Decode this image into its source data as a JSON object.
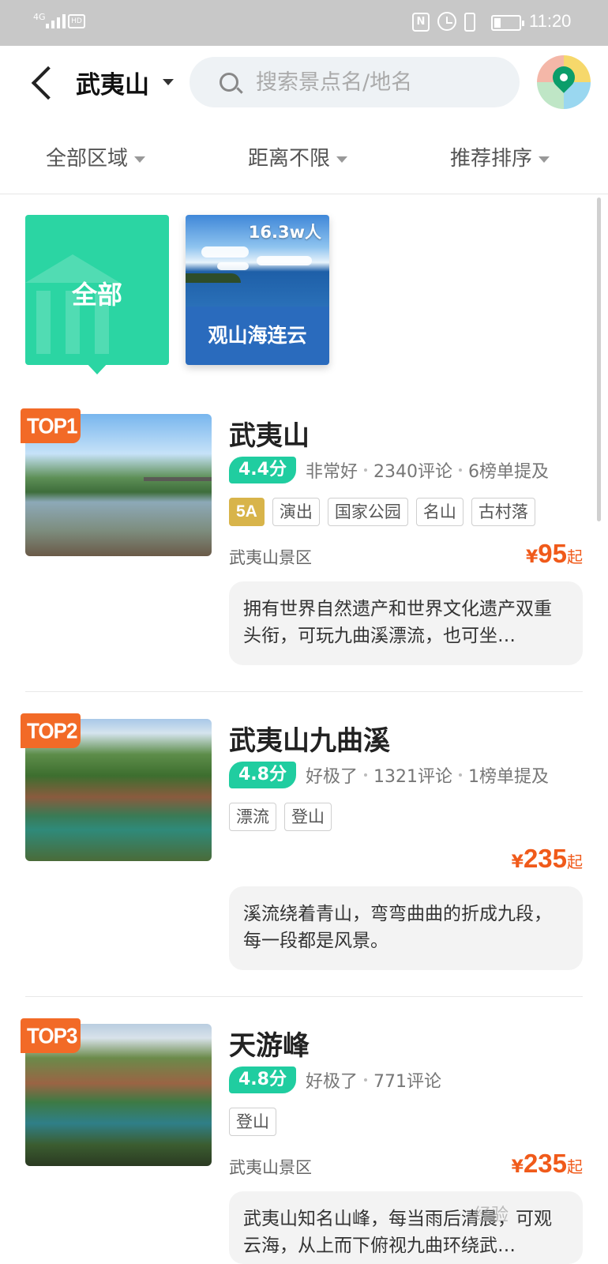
{
  "status_bar": {
    "network": "4G",
    "time": "11:20",
    "hd": "HD"
  },
  "header": {
    "city": "武夷山",
    "search_placeholder": "搜索景点名/地名"
  },
  "filters": [
    "全部区域",
    "距离不限",
    "推荐排序"
  ],
  "categories": {
    "all_label": "全部",
    "featured": {
      "name": "观山海连云",
      "count": "16.3w人"
    }
  },
  "items": [
    {
      "rank": "TOP1",
      "title": "武夷山",
      "score": "4.4分",
      "rating_text": "非常好",
      "reviews": "2340评论",
      "mentions": "6榜单提及",
      "tags": [
        "5A",
        "演出",
        "国家公园",
        "名山",
        "古村落"
      ],
      "area": "武夷山景区",
      "price_symbol": "¥",
      "price": "95",
      "price_suffix": "起",
      "description": "拥有世界自然遗产和世界文化遗产双重头衔，可玩九曲溪漂流，也可坐…"
    },
    {
      "rank": "TOP2",
      "title": "武夷山九曲溪",
      "score": "4.8分",
      "rating_text": "好极了",
      "reviews": "1321评论",
      "mentions": "1榜单提及",
      "tags": [
        "漂流",
        "登山"
      ],
      "area": "",
      "price_symbol": "¥",
      "price": "235",
      "price_suffix": "起",
      "description": "溪流绕着青山，弯弯曲曲的折成九段，每一段都是风景。"
    },
    {
      "rank": "TOP3",
      "title": "天游峰",
      "score": "4.8分",
      "rating_text": "好极了",
      "reviews": "771评论",
      "tags": [
        "登山"
      ],
      "area": "武夷山景区",
      "price_symbol": "¥",
      "price": "235",
      "price_suffix": "起",
      "description": "武夷山知名山峰，每当雨后清晨，可观云海，从上而下俯视九曲环绕武…"
    }
  ],
  "watermark": "经验"
}
